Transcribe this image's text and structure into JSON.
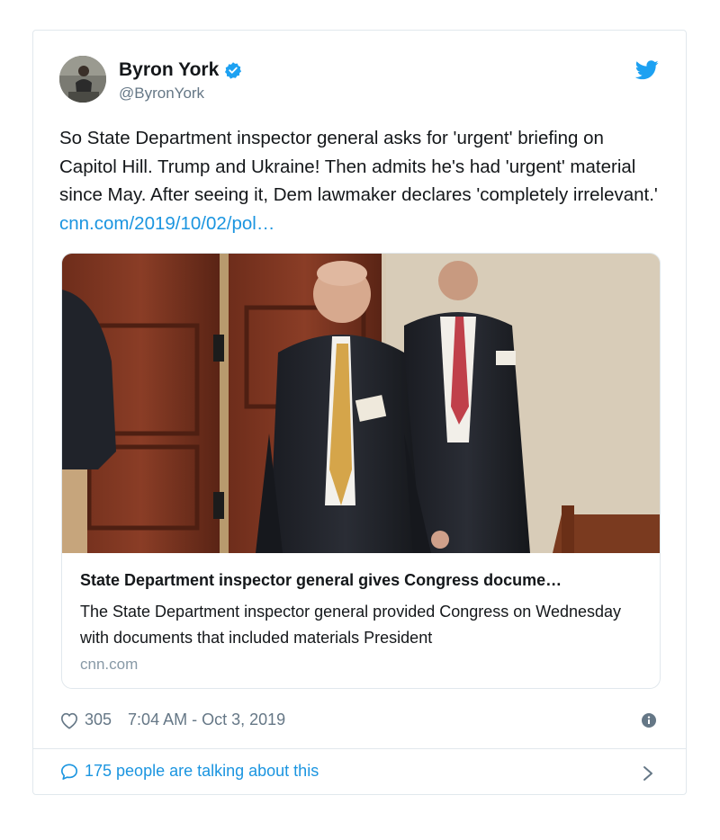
{
  "author": {
    "name": "Byron York",
    "handle": "@ByronYork"
  },
  "tweet": {
    "text": "So State Department inspector general asks for 'urgent' briefing on Capitol Hill. Trump and Ukraine! Then admits he's had 'urgent' material since May. After seeing it, Dem lawmaker declares 'completely irrelevant.' ",
    "link": "cnn.com/2019/10/02/pol…"
  },
  "link_card": {
    "title": "State Department inspector general gives Congress docume…",
    "description": "The State Department inspector general provided Congress on Wednesday with documents that included materials President",
    "domain": "cnn.com"
  },
  "meta": {
    "likes": "305",
    "timestamp": "7:04 AM - Oct 3, 2019"
  },
  "footer": {
    "talking": "175 people are talking about this"
  },
  "icons": {
    "verified": "verified-badge-icon",
    "bird": "twitter-bird-icon",
    "heart": "heart-icon",
    "info": "info-icon",
    "reply": "speech-bubble-icon",
    "chevron": "chevron-right-icon"
  },
  "colors": {
    "accent": "#1b95e0",
    "muted": "#657786",
    "border": "#e1e8ed"
  }
}
